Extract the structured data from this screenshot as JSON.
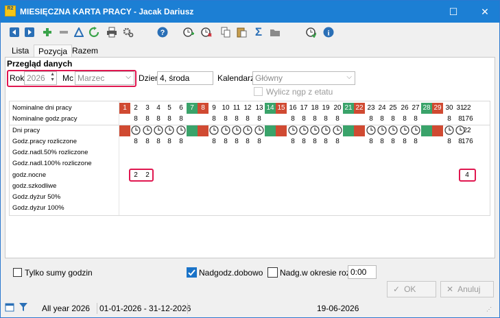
{
  "window": {
    "title": "MIESIĘCZNA KARTA PRACY - Jacak Dariusz",
    "app_icon": "R2"
  },
  "toolbar": {
    "icons": [
      "prev-icon",
      "next-icon",
      "add-icon",
      "remove-icon",
      "triangle-icon",
      "refresh-icon",
      "print-icon",
      "settings-icon",
      "help-icon",
      "add-time-icon",
      "delete-time-icon",
      "copy-icon",
      "paste-icon",
      "sum-icon",
      "folder-icon",
      "clock-go-icon",
      "info-icon"
    ]
  },
  "tabs": [
    "Lista",
    "Pozycja",
    "Razem"
  ],
  "section_title": "Przegląd danych",
  "filters": {
    "rok_label": "Rok",
    "rok_value": "2026",
    "mc_label": "Mc",
    "mc_value": "Marzec",
    "dzien_label": "Dzień",
    "dzien_value": "4, środa",
    "kalendarz_label": "Kalendarz",
    "kalendarz_value": "Główny",
    "wylicz_label": "Wylicz ngp z etatu"
  },
  "calendar": {
    "days": [
      1,
      2,
      3,
      4,
      5,
      6,
      7,
      8,
      9,
      10,
      11,
      12,
      13,
      14,
      15,
      16,
      17,
      18,
      19,
      20,
      21,
      22,
      23,
      24,
      25,
      26,
      27,
      28,
      29,
      30,
      31
    ],
    "red_days": [
      1,
      8,
      15,
      22,
      29
    ],
    "green_days": [
      7,
      14,
      21,
      28
    ],
    "rows": [
      {
        "label": "Nominalne dni pracy",
        "total": "22"
      },
      {
        "label": "Nominalne godz.pracy",
        "total": "176",
        "value": "8"
      },
      {
        "label": "Dni pracy",
        "total": "22"
      },
      {
        "label": "Godz.pracy rozliczone",
        "total": "176",
        "value": "8"
      },
      {
        "label": "Godz.nadl.50% rozliczone",
        "total": ""
      },
      {
        "label": "Godz.nadl.100% rozliczone",
        "total": ""
      },
      {
        "label": "godz.nocne",
        "total": "4",
        "values": {
          "2": "2",
          "3": "2"
        }
      },
      {
        "label": "godz.szkodliwe",
        "total": ""
      },
      {
        "label": "Godz.dyżur 50%",
        "total": ""
      },
      {
        "label": "Godz.dyżur 100%",
        "total": ""
      }
    ]
  },
  "options": {
    "tylko_sumy": "Tylko sumy godzin",
    "nadgodz_dobowo": "Nadgodz.dobowo",
    "nadg_okres": "Nadg.w okresie rozl.",
    "nadg_okres_value": "0:00"
  },
  "buttons": {
    "ok": "OK",
    "anuluj": "Anuluj"
  },
  "status": {
    "period": "All year 2026",
    "range": "01-01-2026 - 31-12-2026",
    "date": "19-06-2026"
  }
}
